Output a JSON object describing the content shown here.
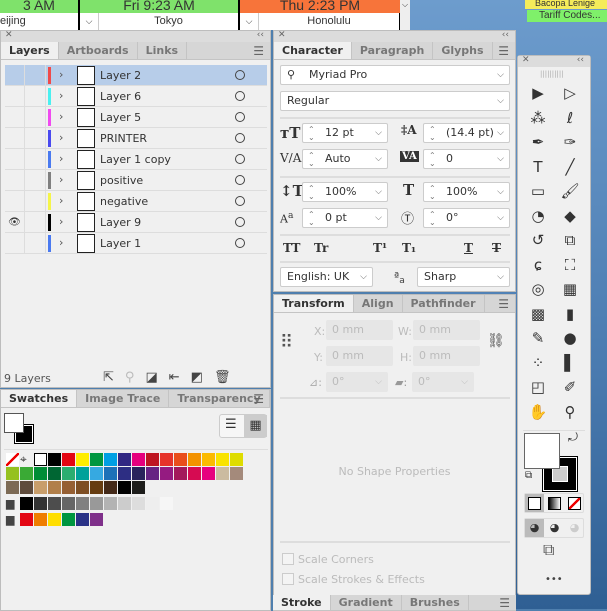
{
  "clocks": {
    "top": [
      {
        "label": "3 AM",
        "color": "#7fe26b"
      },
      {
        "label": "Fri 9:23 AM",
        "color": "#7fe26b"
      },
      {
        "label": "Thu 2:23 PM",
        "color": "#f7743a"
      }
    ],
    "cities": [
      "eijing",
      "Tokyo",
      "Honolulu"
    ]
  },
  "stickies": [
    {
      "label": "Bacopa Lenige",
      "color": "#f5ec5a"
    },
    {
      "label": "Tariff Codes...",
      "color": "#7ff06a"
    }
  ],
  "layers": {
    "tabs": [
      "Layers",
      "Artboards",
      "Links"
    ],
    "rows": [
      {
        "name": "Layer 2",
        "color": "#f04a4a",
        "selected": true,
        "visible": false
      },
      {
        "name": "Layer 6",
        "color": "#4af0f0",
        "selected": false,
        "visible": false
      },
      {
        "name": "Layer 5",
        "color": "#f04af0",
        "selected": false,
        "visible": false
      },
      {
        "name": "PRINTER",
        "color": "#4a4af0",
        "selected": false,
        "visible": false
      },
      {
        "name": "Layer 1 copy",
        "color": "#4a7af0",
        "selected": false,
        "visible": false
      },
      {
        "name": "positive",
        "color": "#808080",
        "selected": false,
        "visible": false
      },
      {
        "name": "negative",
        "color": "#f5f54a",
        "selected": false,
        "visible": false
      },
      {
        "name": "Layer 9",
        "color": "#000000",
        "selected": false,
        "visible": true
      },
      {
        "name": "Layer 1",
        "color": "#4a7af0",
        "selected": false,
        "visible": false
      }
    ],
    "count": "9 Layers"
  },
  "swatches": {
    "tabs": [
      "Swatches",
      "Image Trace",
      "Transparency"
    ],
    "rows": [
      [
        "none",
        "reg",
        "#ffffff",
        "#000000",
        "#e30613",
        "#ffed00",
        "#009640",
        "#009fe3",
        "#312783",
        "#e5007e",
        "#be1622",
        "#e6332a",
        "#e94e1b",
        "#f39200",
        "#fbba00",
        "#f9e300",
        "#dedc00"
      ],
      [
        "#95c11f",
        "#3aaa35",
        "#008d36",
        "#006633",
        "#2bad70",
        "#00a19a",
        "#36a9e1",
        "#1d71b8",
        "#2d2e83",
        "#29235c",
        "#662483",
        "#951b81",
        "#a3195b",
        "#d60b52",
        "#e6007e",
        "#cbbba0",
        "#a48a7b"
      ],
      [
        "#7c6a55",
        "#5e4b3c",
        "#c89e6b",
        "#b17f4a",
        "#955f33",
        "#7d4e24",
        "#663c11",
        "#432918",
        "#000000",
        "#1d1d1b"
      ],
      [
        "folder",
        "#000000",
        "#333333",
        "#4d4d4d",
        "#666666",
        "#808080",
        "#999999",
        "#b3b3b3",
        "#cccccc",
        "#dddddd",
        "#eeeeee",
        "#f6f6f6"
      ],
      [
        "folder",
        "#e30613",
        "#ef7d00",
        "#ffde00",
        "#009640",
        "#2a3287",
        "#7f308a"
      ]
    ]
  },
  "character": {
    "tabs": [
      "Character",
      "Paragraph",
      "Glyphs"
    ],
    "font": "Myriad Pro",
    "style": "Regular",
    "size": "12 pt",
    "leading": "(14.4 pt)",
    "kerning": "Auto",
    "tracking": "0",
    "vscale": "100%",
    "hscale": "100%",
    "baseline": "0 pt",
    "rotation": "0°",
    "language": "English: UK",
    "antialias": "Sharp",
    "buttons": [
      "TT",
      "Tr",
      "T¹",
      "T₁",
      "T",
      "T"
    ]
  },
  "transform": {
    "tabs": [
      "Transform",
      "Align",
      "Pathfinder"
    ],
    "x": "0 mm",
    "y": "0 mm",
    "w": "0 mm",
    "h": "0 mm",
    "angle": "0°",
    "shear": "0°",
    "labels": [
      "X:",
      "Y:",
      "W:",
      "H:"
    ],
    "empty": "No Shape Properties",
    "scale_corners": "Scale Corners",
    "scale_strokes": "Scale Strokes & Effects"
  },
  "bottom_tabs": [
    "Stroke",
    "Gradient",
    "Brushes"
  ],
  "tools": [
    [
      "selection",
      "▶"
    ],
    [
      "direct-selection",
      "▷"
    ],
    [
      "magic-wand",
      "⁂"
    ],
    [
      "lasso",
      "ℓ"
    ],
    [
      "pen",
      "✒"
    ],
    [
      "curvature",
      "✑"
    ],
    [
      "type",
      "T"
    ],
    [
      "line",
      "╱"
    ],
    [
      "rectangle",
      "▭"
    ],
    [
      "paintbrush",
      "🖌"
    ],
    [
      "shaper",
      "◔"
    ],
    [
      "eraser",
      "◆"
    ],
    [
      "rotate",
      "↺"
    ],
    [
      "scale",
      "⧉"
    ],
    [
      "warp",
      "ɕ"
    ],
    [
      "free-transform",
      "⛶"
    ],
    [
      "shape-builder",
      "◎"
    ],
    [
      "perspective",
      "▦"
    ],
    [
      "mesh",
      "▩"
    ],
    [
      "gradient",
      "▮"
    ],
    [
      "eyedropper",
      "✎"
    ],
    [
      "blend",
      "●"
    ],
    [
      "symbol-sprayer",
      "⁘"
    ],
    [
      "column-graph",
      "▌"
    ],
    [
      "artboard",
      "◰"
    ],
    [
      "slice",
      "✐"
    ],
    [
      "hand",
      "✋"
    ],
    [
      "zoom",
      "⚲"
    ]
  ],
  "more": "•••"
}
